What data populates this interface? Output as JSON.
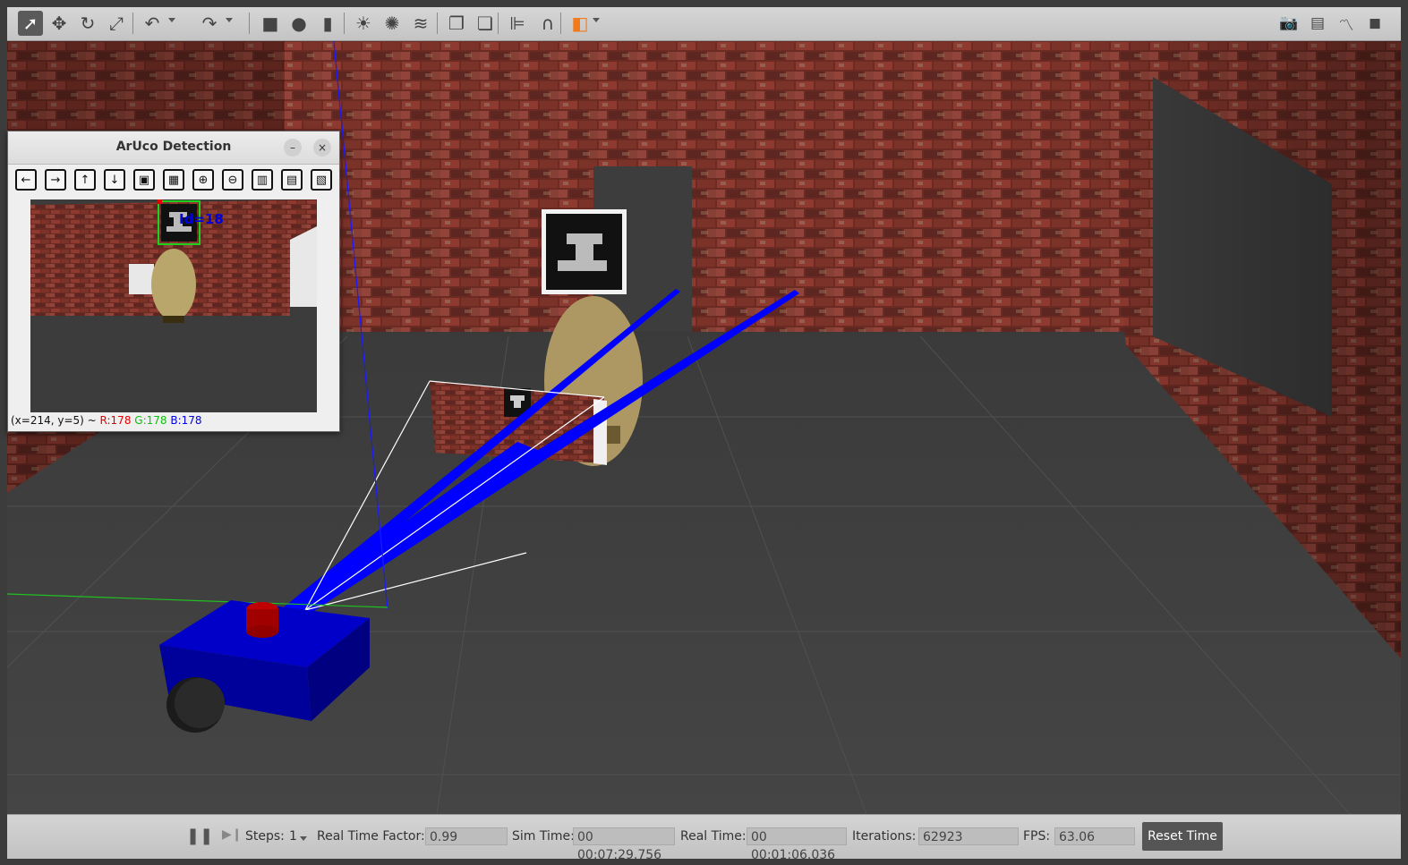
{
  "toolbar": {
    "left_tools": [
      {
        "name": "select-arrow-icon",
        "glyph": "➚"
      },
      {
        "name": "translate-icon",
        "glyph": "✥"
      },
      {
        "name": "rotate-icon",
        "glyph": "↻"
      },
      {
        "name": "scale-icon",
        "glyph": "⤢"
      },
      {
        "name": "undo-icon",
        "glyph": "↶"
      },
      {
        "name": "redo-icon",
        "glyph": "↷"
      },
      {
        "name": "box-icon",
        "glyph": "■"
      },
      {
        "name": "sphere-icon",
        "glyph": "●"
      },
      {
        "name": "cylinder-icon",
        "glyph": "▮"
      },
      {
        "name": "point-light-icon",
        "glyph": "☀"
      },
      {
        "name": "spot-light-icon",
        "glyph": "✺"
      },
      {
        "name": "directional-light-icon",
        "glyph": "≋"
      },
      {
        "name": "copy-icon",
        "glyph": "❐"
      },
      {
        "name": "paste-icon",
        "glyph": "❏"
      },
      {
        "name": "align-icon",
        "glyph": "⊫"
      },
      {
        "name": "snap-icon",
        "glyph": "∩"
      },
      {
        "name": "view-angle-icon",
        "glyph": "◧"
      }
    ],
    "right_tools": [
      {
        "name": "screenshot-icon",
        "glyph": "📷"
      },
      {
        "name": "log-icon",
        "glyph": "▤"
      },
      {
        "name": "plot-icon",
        "glyph": "〽"
      },
      {
        "name": "video-record-icon",
        "glyph": "◼"
      }
    ],
    "accent_color": "#f07a1c"
  },
  "aruco_window": {
    "title": "ArUco Detection",
    "minimize_glyph": "–",
    "close_glyph": "×",
    "tools": [
      {
        "name": "pan-left-icon",
        "glyph": "←"
      },
      {
        "name": "pan-right-icon",
        "glyph": "→"
      },
      {
        "name": "pan-up-icon",
        "glyph": "↑"
      },
      {
        "name": "pan-down-icon",
        "glyph": "↓"
      },
      {
        "name": "zoom-fit-icon",
        "glyph": "▣"
      },
      {
        "name": "zoom-original-icon",
        "glyph": "▦"
      },
      {
        "name": "zoom-in-icon",
        "glyph": "⊕"
      },
      {
        "name": "zoom-out-icon",
        "glyph": "⊖"
      },
      {
        "name": "save-image-icon",
        "glyph": "▥"
      },
      {
        "name": "copy-clipboard-icon",
        "glyph": "▤"
      },
      {
        "name": "properties-icon",
        "glyph": "▧"
      }
    ],
    "marker_label": "Id=18",
    "status_coords": "(x=214, y=5) ~ ",
    "status_r": "R:178",
    "status_g": "G:178",
    "status_b": "B:178",
    "color_r": "#e00000",
    "color_g": "#10c010",
    "color_b": "#0000e0"
  },
  "bottombar": {
    "pause_glyph": "❚❚",
    "step_glyph": "▶❙",
    "steps_label": "Steps:",
    "steps_value": "1",
    "rtf_label": "Real Time Factor:",
    "rtf_value": "0.99",
    "sim_time_label": "Sim Time:",
    "sim_time_value": "00 00:07:29.756",
    "real_time_label": "Real Time:",
    "real_time_value": "00 00:01:06.036",
    "iterations_label": "Iterations:",
    "iterations_value": "62923",
    "fps_label": "FPS:",
    "fps_value": "63.06",
    "reset_label": "Reset Time"
  }
}
